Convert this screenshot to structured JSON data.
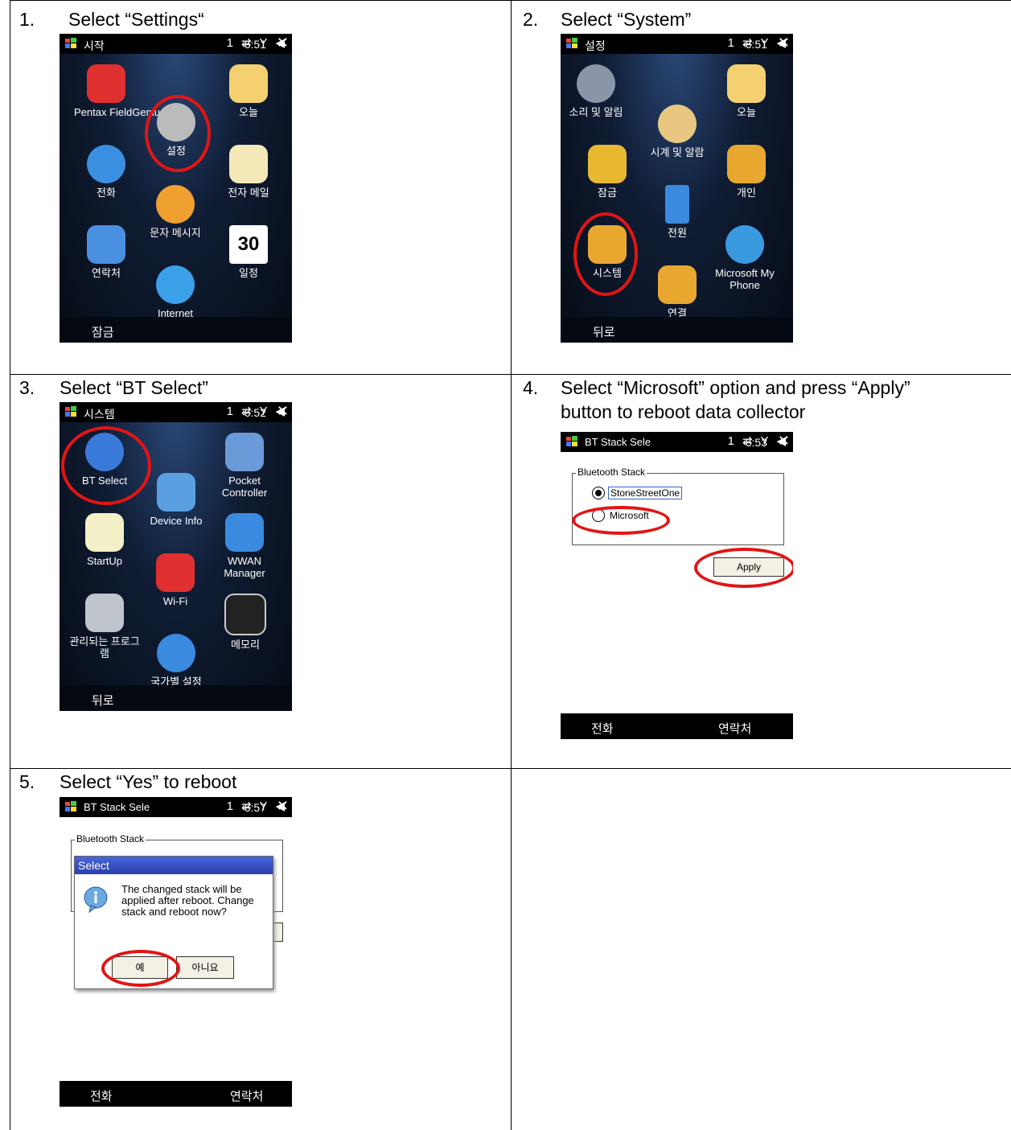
{
  "steps": [
    {
      "num": "1.",
      "text": "Select “Settings“"
    },
    {
      "num": "2.",
      "text": "Select “System”"
    },
    {
      "num": "3.",
      "text": "Select “BT Select”"
    },
    {
      "num": "4.",
      "line1": "Select “Microsoft” option and press “Apply”",
      "line2": "button to reboot data collector"
    },
    {
      "num": "5.",
      "text": "Select “Yes” to reboot"
    }
  ],
  "screen1": {
    "title": "시작",
    "time": "6:51",
    "icons": [
      "Pentax FieldGenius",
      "설정",
      "오늘",
      "전화",
      "전자 메일",
      "문자 메시지",
      "연락처",
      "일정",
      "Internet"
    ],
    "calendar_day": "30",
    "softkey_left": "잠금"
  },
  "screen2": {
    "title": "설정",
    "time": "6:51",
    "icons": [
      "소리 및 알림",
      "오늘",
      "시계 및 알람",
      "잠금",
      "개인",
      "전원",
      "시스템",
      "Microsoft My Phone",
      "연결"
    ],
    "softkey_left": "뒤로"
  },
  "screen3": {
    "title": "시스템",
    "time": "6:52",
    "icons": [
      "BT Select",
      "Pocket Controller",
      "Device Info",
      "StartUp",
      "WWAN Manager",
      "Wi-Fi",
      "관리되는 프로그램",
      "메모리",
      "국가별 설정"
    ],
    "softkey_left": "뒤로"
  },
  "screen4": {
    "title": "BT Stack Sele",
    "time": "6:53",
    "group_label": "Bluetooth Stack",
    "option1": "StoneStreetOne",
    "option2": "Microsoft",
    "apply": "Apply",
    "softkey_left": "전화",
    "softkey_right": "연락처"
  },
  "screen5": {
    "title": "BT Stack Sele",
    "time": "6:57",
    "group_label": "Bluetooth Stack",
    "dialog_title": "Select",
    "message": "The changed stack will be applied after reboot. Change stack and reboot now?",
    "yes": "예",
    "no": "아니요",
    "softkey_left": "전화",
    "softkey_right": "연락처"
  },
  "status_icons": "1 ⇄ Y ◀",
  "colors": {
    "highlight": "#e21515",
    "dialog_bar": "#2a3fae"
  }
}
